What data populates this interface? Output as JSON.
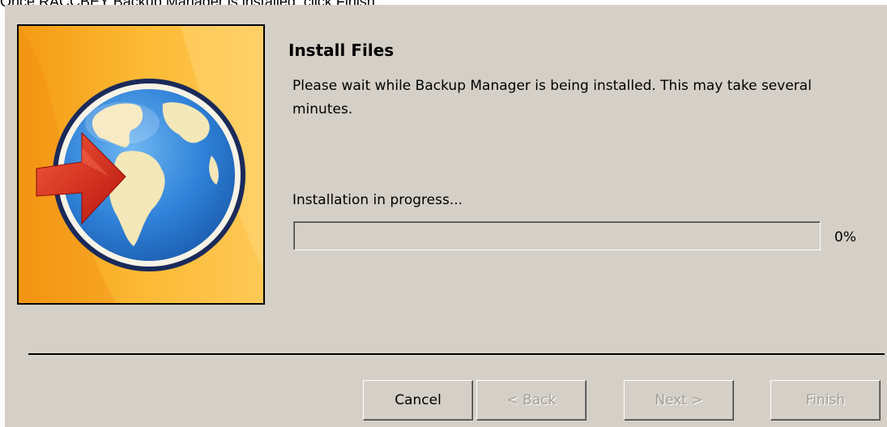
{
  "caption": "Once RACCBEY Backup Manager is installed, click Finish.",
  "dialog": {
    "title": "Install Files",
    "description": "Please wait while Backup Manager is being installed. This may take several minutes.",
    "status": "Installation in progress...",
    "progress": {
      "percent_label": "0%",
      "fraction": 0
    }
  },
  "buttons": {
    "cancel": "Cancel",
    "back": "< Back",
    "next": "Next >",
    "finish": "Finish"
  },
  "banner": {
    "icon": "globe-arrow-icon"
  },
  "colors": {
    "dialog_bg": "#d4d0c8",
    "banner_bg": "#fcb934",
    "globe": "#2f82d8",
    "arrow": "#d8281c"
  }
}
